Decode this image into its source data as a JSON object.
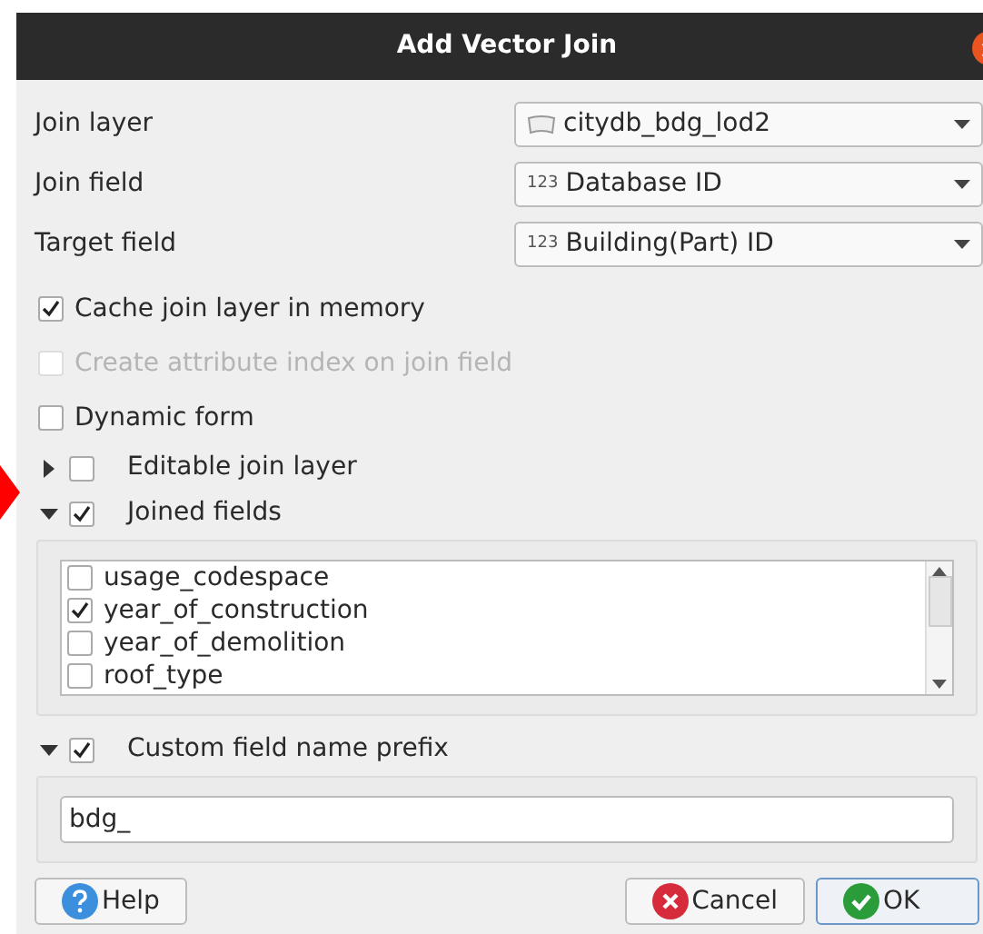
{
  "window": {
    "title": "Add Vector Join"
  },
  "fields": [
    {
      "label": "Join layer",
      "value": "citydb_bdg_lod2",
      "kind": "layer"
    },
    {
      "label": "Join field",
      "value": "Database ID",
      "kind": "number",
      "type_tag": "123"
    },
    {
      "label": "Target field",
      "value": "Building(Part) ID",
      "kind": "number",
      "type_tag": "123"
    }
  ],
  "options": [
    {
      "label": "Cache join layer in memory",
      "checked": true,
      "disabled": false
    },
    {
      "label": "Create attribute index on join field",
      "checked": false,
      "disabled": true
    },
    {
      "label": "Dynamic form",
      "checked": false,
      "disabled": false
    }
  ],
  "sections": [
    {
      "label": "Editable join layer",
      "expanded": false,
      "checked": false
    },
    {
      "label": "Joined fields",
      "expanded": true,
      "checked": true,
      "kind": "list",
      "items": [
        {
          "label": "usage_codespace",
          "checked": false
        },
        {
          "label": "year_of_construction",
          "checked": true
        },
        {
          "label": "year_of_demolition",
          "checked": false
        },
        {
          "label": "roof_type",
          "checked": false
        }
      ]
    },
    {
      "label": "Custom field name prefix",
      "expanded": true,
      "checked": true,
      "kind": "input",
      "value": "bdg_"
    }
  ],
  "buttons": [
    {
      "label": "Help",
      "kind": "help",
      "selected": false
    },
    {
      "label": "Cancel",
      "kind": "cancel",
      "selected": false
    },
    {
      "label": "OK",
      "kind": "ok",
      "selected": true
    }
  ]
}
